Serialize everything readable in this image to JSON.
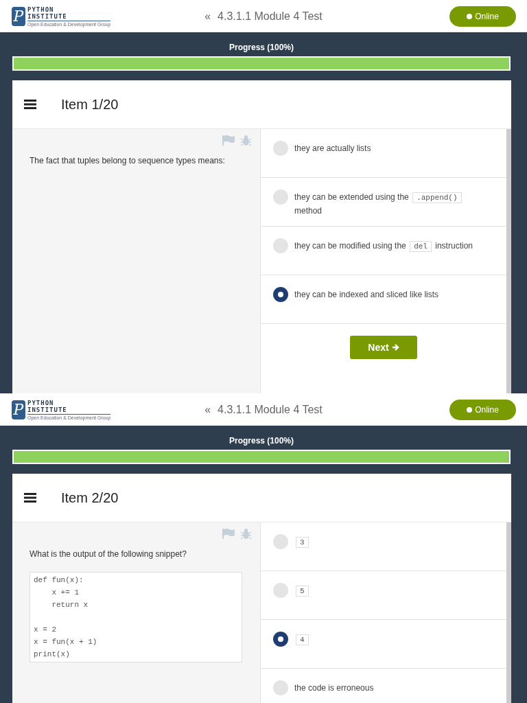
{
  "screens": [
    {
      "header": {
        "logo": {
          "mark": "P",
          "line_1": "PYTHON",
          "line_2": "INSTITUTE",
          "tagline": "Open Education & Development Group"
        },
        "back": "«",
        "title": "4.3.1.1 Module 4 Test",
        "status": {
          "label": "Online",
          "online": true
        }
      },
      "progress": {
        "label": "Progress (100%)",
        "level": 1
      },
      "item_title": "Item 1/20",
      "question": "The fact that tuples belong to sequence types means:",
      "options": [
        {
          "selected": false,
          "segments": [
            {
              "kind": "text",
              "text": "they are actually lists"
            }
          ]
        },
        {
          "selected": false,
          "segments": [
            {
              "kind": "text",
              "text": "they can be extended using the"
            },
            {
              "kind": "code",
              "text": ".append()"
            },
            {
              "kind": "text",
              "text": "method"
            }
          ]
        },
        {
          "selected": false,
          "segments": [
            {
              "kind": "text",
              "text": "they can be modified using the"
            },
            {
              "kind": "code",
              "text": "del"
            },
            {
              "kind": "text",
              "text": "instruction"
            }
          ]
        },
        {
          "selected": true,
          "segments": [
            {
              "kind": "text",
              "text": "they can be indexed and sliced like lists"
            }
          ]
        }
      ],
      "next_button": "Next"
    },
    {
      "header": {
        "logo": {
          "mark": "P",
          "line_1": "PYTHON",
          "line_2": "INSTITUTE",
          "tagline": "Open Education & Development Group"
        },
        "back": "«",
        "title": "4.3.1.1 Module 4 Test",
        "status": {
          "label": "Online",
          "online": true
        }
      },
      "progress": {
        "label": "Progress (100%)",
        "level": 1
      },
      "item_title": "Item 2/20",
      "question": "What is the output of the following snippet?",
      "code": "def fun(x):\n    x += 1\n    return x\n\nx = 2\nx = fun(x + 1)\nprint(x)",
      "options": [
        {
          "selected": false,
          "segments": [
            {
              "kind": "code",
              "text": "3"
            }
          ]
        },
        {
          "selected": false,
          "segments": [
            {
              "kind": "code",
              "text": "5"
            }
          ]
        },
        {
          "selected": true,
          "segments": [
            {
              "kind": "code",
              "text": "4"
            }
          ]
        },
        {
          "selected": false,
          "segments": [
            {
              "kind": "text",
              "text": "the code is erroneous"
            }
          ]
        }
      ]
    }
  ]
}
